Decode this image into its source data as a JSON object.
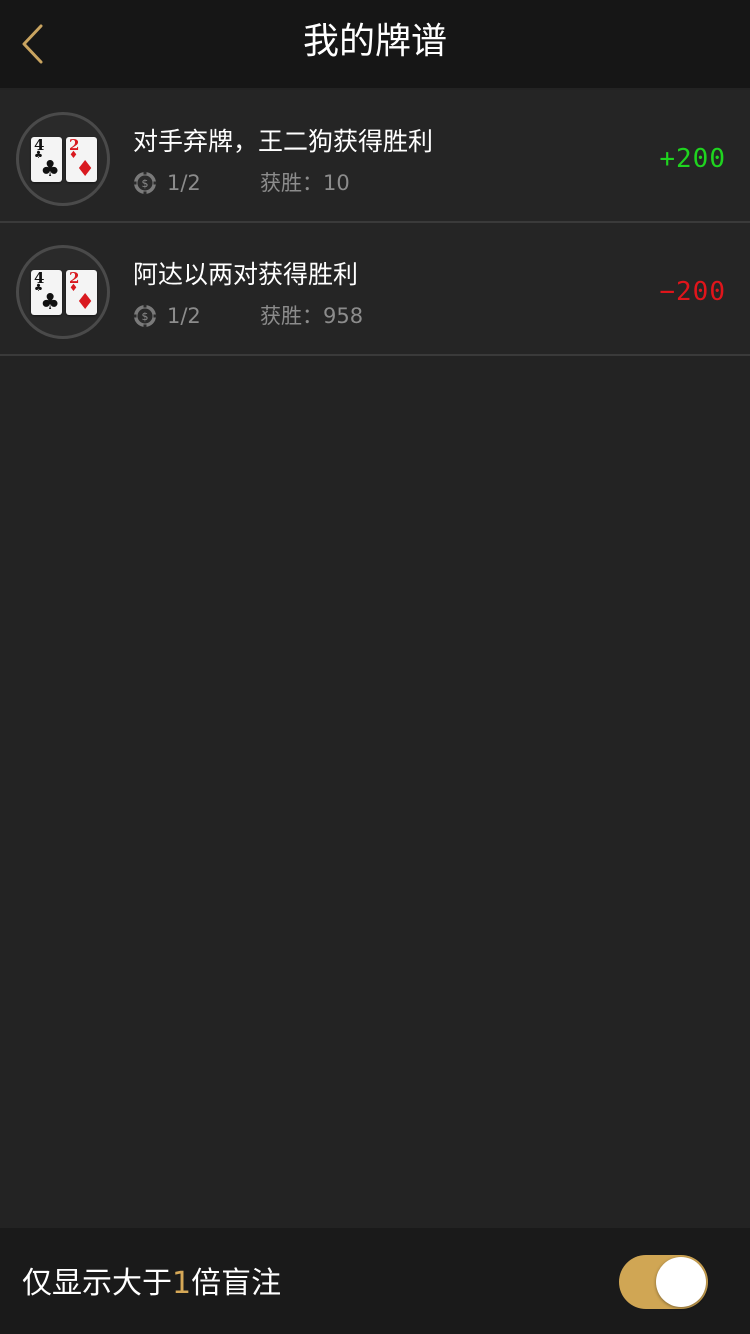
{
  "header": {
    "title": "我的牌谱",
    "back_icon": "chevron-left-icon",
    "accent": "#c9a460"
  },
  "hands": [
    {
      "cards": [
        {
          "rank": "4",
          "suit": "♣",
          "color": "black"
        },
        {
          "rank": "2",
          "suit": "♦",
          "color": "red"
        }
      ],
      "title": "对手弃牌，王二狗获得胜利",
      "chip_icon": "chip-icon",
      "blinds": "1/2",
      "wins_text": "获胜：10",
      "amount": "+200",
      "amount_color": "#1fd41f"
    },
    {
      "cards": [
        {
          "rank": "4",
          "suit": "♣",
          "color": "black"
        },
        {
          "rank": "2",
          "suit": "♦",
          "color": "red"
        }
      ],
      "title": "阿达以两对获得胜利",
      "chip_icon": "chip-icon",
      "blinds": "1/2",
      "wins_text": "获胜：958",
      "amount": "−200",
      "amount_color": "#e0151b"
    }
  ],
  "footer": {
    "label_before": "仅显示大于",
    "label_highlight": "1",
    "label_after": "倍盲注",
    "toggle_on": true,
    "toggle_color": "#d0a654"
  }
}
